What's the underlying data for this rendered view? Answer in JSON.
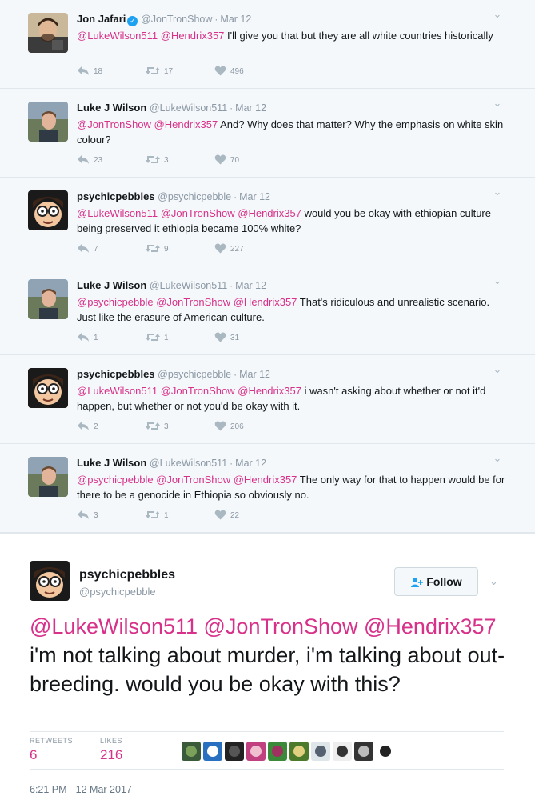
{
  "thread": [
    {
      "name": "Jon Jafari",
      "verified": true,
      "handle": "@JonTronShow",
      "time": "Mar 12",
      "mentions": "@LukeWilson511 @Hendrix357",
      "body": " I'll give you that but they are all white countries historically",
      "replies": "18",
      "retweets": "17",
      "likes": "496",
      "avatar": "jon-avatar"
    },
    {
      "name": "Luke J Wilson",
      "verified": false,
      "handle": "@LukeWilson511",
      "time": "Mar 12",
      "mentions": "@JonTronShow @Hendrix357",
      "body": " And? Why does that matter? Why the emphasis on white skin colour?",
      "replies": "23",
      "retweets": "3",
      "likes": "70",
      "avatar": "luke-avatar"
    },
    {
      "name": "psychicpebbles",
      "verified": false,
      "handle": "@psychicpebble",
      "time": "Mar 12",
      "mentions": "@LukeWilson511 @JonTronShow @Hendrix357",
      "body": " would you be okay with ethiopian culture being preserved it ethiopia became 100% white?",
      "replies": "7",
      "retweets": "9",
      "likes": "227",
      "avatar": "pebbles-avatar"
    },
    {
      "name": "Luke J Wilson",
      "verified": false,
      "handle": "@LukeWilson511",
      "time": "Mar 12",
      "mentions": "@psychicpebble @JonTronShow @Hendrix357",
      "body": " That's ridiculous and unrealistic scenario. Just like the erasure of American culture.",
      "replies": "1",
      "retweets": "1",
      "likes": "31",
      "avatar": "luke-avatar"
    },
    {
      "name": "psychicpebbles",
      "verified": false,
      "handle": "@psychicpebble",
      "time": "Mar 12",
      "mentions": "@LukeWilson511 @JonTronShow @Hendrix357",
      "body": " i wasn't asking about whether or not it'd happen, but whether or not you'd be okay with it.",
      "replies": "2",
      "retweets": "3",
      "likes": "206",
      "avatar": "pebbles-avatar"
    },
    {
      "name": "Luke J Wilson",
      "verified": false,
      "handle": "@LukeWilson511",
      "time": "Mar 12",
      "mentions": "@psychicpebble @JonTronShow @Hendrix357",
      "body": " The only way for that to happen would be for there to be a genocide in Ethiopia so obviously no.",
      "replies": "3",
      "retweets": "1",
      "likes": "22",
      "avatar": "luke-avatar"
    }
  ],
  "main_tweet": {
    "name": "psychicpebbles",
    "handle": "@psychicpebble",
    "follow_label": "Follow",
    "mentions": "@LukeWilson511 @JonTronShow @Hendrix357",
    "body": " i'm not talking about murder, i'm talking about out-breeding. would you be okay with this?",
    "retweets_label": "RETWEETS",
    "retweets": "6",
    "likes_label": "LIKES",
    "likes": "216",
    "timestamp": "6:21 PM - 12 Mar 2017"
  },
  "colors": {
    "mention": "#d7318a",
    "muted": "#8b98a5",
    "verified": "#1da1f2",
    "thread_bg": "#f5f8fa"
  },
  "icons": [
    "reply-icon",
    "retweet-icon",
    "heart-icon",
    "chevron-down-icon",
    "follow-person-icon",
    "verified-badge-icon"
  ]
}
